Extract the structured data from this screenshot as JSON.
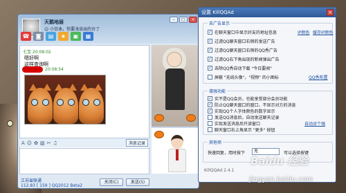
{
  "chat": {
    "contact_name": "天鹅地层",
    "signature": "☺ 小日本，你要浅谈出的台了",
    "messages": [
      {
        "meta": "七宝  20:08:02",
        "text": "嗯好啊"
      },
      {
        "meta": "",
        "text": "这样查询啊"
      },
      {
        "meta": "20:08:54",
        "text": ""
      }
    ],
    "history_label": "消息记录",
    "footer_link": "江苏省联通",
    "footer_status": "112.83  [ 159 ] QQ2012 Beta2",
    "close_label": "关闭(C)",
    "send_label": "发送(S)",
    "win_controls": [
      "–",
      "□",
      "×"
    ],
    "toolbar_icons": [
      "phone-icon",
      "video-icon",
      "file-icon",
      "app-icon",
      "screen-icon",
      "more-icon"
    ],
    "input_icons": [
      "font-icon",
      "emoji-icon",
      "sticker-icon",
      "image-icon",
      "scissors-icon",
      "music-icon"
    ]
  },
  "dialog": {
    "title": "设置 KillQQAd",
    "close": "×",
    "ads_group": "去广告显示",
    "ads_options": [
      {
        "label": "在聊天窗口中显示好友的地址信息",
        "checked": true
      },
      {
        "label": "过滤QQ聊天窗口右侧的发送广告",
        "checked": true
      },
      {
        "label": "过滤QQ聊天窗口右侧的QQ秀广告",
        "checked": true
      },
      {
        "label": "过滤QQ右下角出现的新闻弹出广告",
        "checked": true
      },
      {
        "label": "去除QQ秀自动下载 \"今日要闻\"",
        "checked": true
      },
      {
        "label": "屏蔽 \"无线头像\"，\"视频\" 的小图标",
        "checked": false
      }
    ],
    "ads_links": {
      "ip": "IP颜色",
      "cache": "缓存IP颜色",
      "qqshow": "QQ秀布置"
    },
    "enhance_group": "增强功能",
    "enhance_options": [
      {
        "label": "实不是QQ会员，也能享受部分会员功能",
        "checked": true
      },
      {
        "label": "防止QQ聊天窗口的窗口，不显示对方的消息",
        "checked": true
      },
      {
        "label": "实现QQ个人字体颜色的数字显示",
        "checked": true
      },
      {
        "label": "发送QQ消息后，自动发送聊天记录",
        "checked": false
      },
      {
        "label": "实现发送消息后只读窗口",
        "checked": false
      },
      {
        "label": "聊天窗口右上角显示 \"更多\" 按钮",
        "checked": false
      }
    ],
    "enhance_link": "自动对个强",
    "other_group": "其他项",
    "reply_label": "快速回复，用时按下",
    "reply_value": "无",
    "reply_hint": "可以选择按键",
    "version": "KillQQAd 2.4.1"
  },
  "watermark": {
    "brand": "Baidu 经验",
    "url": "jingyan.baidu.com"
  },
  "colors": {
    "accent": "#1a4fa0",
    "titlebar": "#3a68a8",
    "alert_red": "#d40000"
  }
}
